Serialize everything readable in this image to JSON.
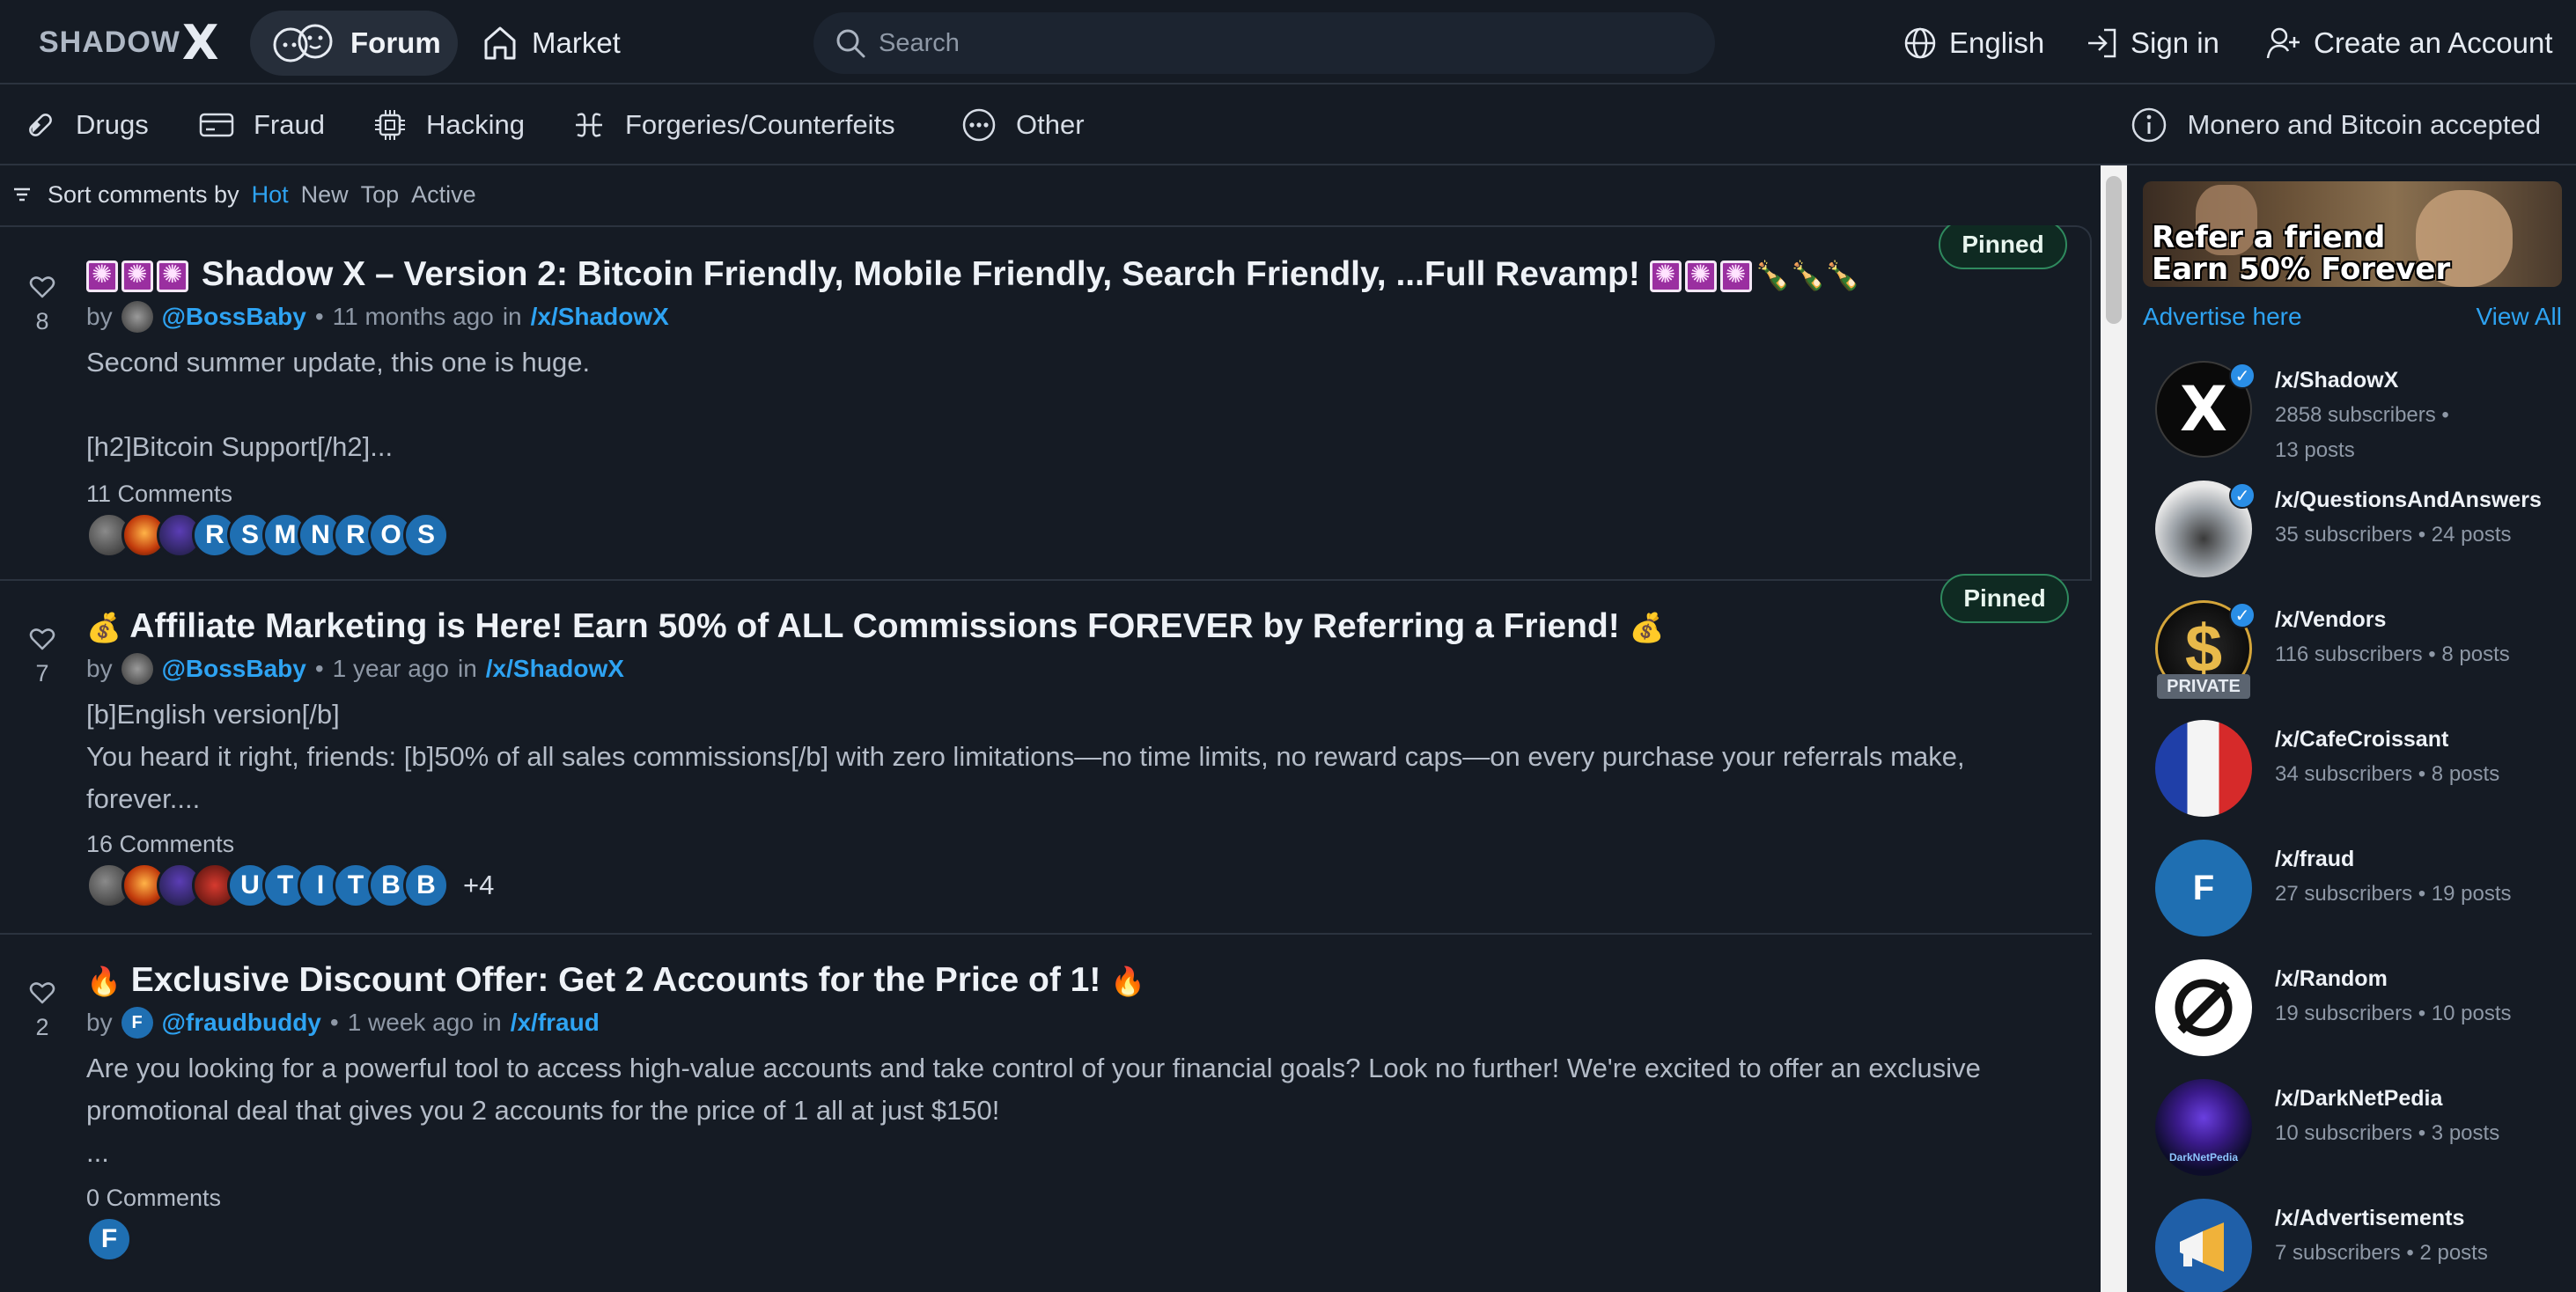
{
  "brand": {
    "name": "SHADOW",
    "mark": "X"
  },
  "nav": {
    "forum": "Forum",
    "market": "Market"
  },
  "search": {
    "placeholder": "Search"
  },
  "top_right": {
    "language": "English",
    "sign_in": "Sign in",
    "create_account": "Create an Account"
  },
  "categories": [
    "Drugs",
    "Fraud",
    "Hacking",
    "Forgeries/Counterfeits",
    "Other"
  ],
  "accepted_notice": "Monero and Bitcoin accepted",
  "sort": {
    "label": "Sort comments by",
    "options": [
      "Hot",
      "New",
      "Top",
      "Active"
    ],
    "active": "Hot"
  },
  "posts": [
    {
      "votes": "8",
      "title": "Shadow X – Version 2: Bitcoin Friendly, Mobile Friendly, Search Friendly, ...Full Revamp!",
      "title_trailing_emoji": "🍾🍾🍾",
      "pinned": "Pinned",
      "by": "by",
      "author": "@BossBaby",
      "time": "11 months ago",
      "in": "in",
      "community": "/x/ShadowX",
      "body_1": "Second summer update, this one is huge.",
      "body_2": "[h2]Bitcoin Support[/h2]...",
      "comments": "11 Comments",
      "avatar_letters": [
        "R",
        "S",
        "M",
        "N",
        "R",
        "O",
        "S"
      ]
    },
    {
      "votes": "7",
      "title": "Affiliate Marketing is Here! Earn 50% of ALL Commissions FOREVER by Referring a Friend!",
      "title_emoji": "💰",
      "pinned": "Pinned",
      "by": "by",
      "author": "@BossBaby",
      "time": "1 year ago",
      "in": "in",
      "community": "/x/ShadowX",
      "body_1": "[b]English version[/b]",
      "body_2": "You heard it right, friends: [b]50% of all sales commissions[/b] with zero limitations—no time limits, no reward caps—on every purchase your referrals make, forever....",
      "comments": "16 Comments",
      "avatar_letters": [
        "U",
        "T",
        "I",
        "T",
        "B",
        "B"
      ],
      "more": "+4"
    },
    {
      "votes": "2",
      "title": "Exclusive Discount Offer: Get 2 Accounts for the Price of 1!",
      "title_emoji": "🔥",
      "by": "by",
      "author_initial": "F",
      "author": "@fraudbuddy",
      "time": "1 week ago",
      "in": "in",
      "community": "/x/fraud",
      "body_1": "Are you looking for a powerful tool to access high-value accounts and take control of your financial goals? Look no further! We're excited to offer an exclusive promotional deal that gives you 2 accounts for the price of 1   all at just $150!",
      "body_2": "...",
      "comments": "0 Comments",
      "avatar_letters": [
        "F"
      ]
    }
  ],
  "sidebar": {
    "ad_text": "Refer a friend\nEarn 50% Forever",
    "advertise": "Advertise here",
    "view_all": "View All",
    "communities": [
      {
        "name": "/x/ShadowX",
        "stats_1": "2858 subscribers •",
        "stats_2": "13 posts",
        "verified": true
      },
      {
        "name": "/x/QuestionsAndAnswers",
        "stats_1": "35 subscribers • 24 posts",
        "verified": true
      },
      {
        "name": "/x/Vendors",
        "stats_1": "116 subscribers • 8 posts",
        "verified": true,
        "private_label": "PRIVATE",
        "symbol": "$"
      },
      {
        "name": "/x/CafeCroissant",
        "stats_1": "34 subscribers • 8 posts"
      },
      {
        "name": "/x/fraud",
        "stats_1": "27 subscribers • 19 posts",
        "initial": "F"
      },
      {
        "name": "/x/Random",
        "stats_1": "19 subscribers • 10 posts"
      },
      {
        "name": "/x/DarkNetPedia",
        "stats_1": "10 subscribers • 3 posts",
        "logo_text": "DarkNetPedia"
      },
      {
        "name": "/x/Advertisements",
        "stats_1": "7 subscribers • 2 posts"
      }
    ]
  },
  "colors": {
    "accent": "#2ea3f2",
    "background": "#151b24",
    "pinned_border": "#2f8a5e"
  }
}
